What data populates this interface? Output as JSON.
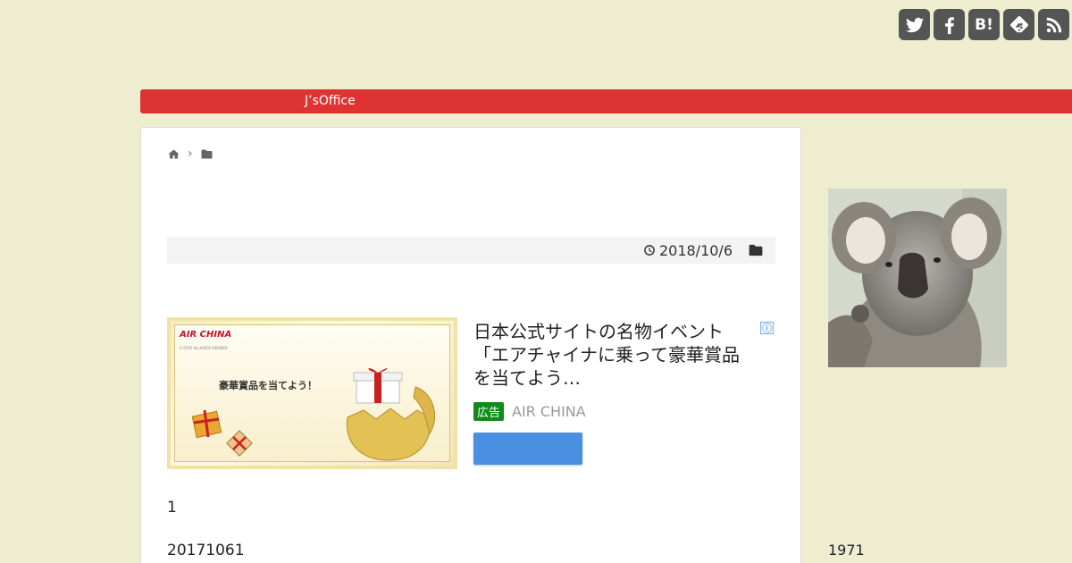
{
  "social": {
    "items": [
      {
        "name": "twitter-icon",
        "glyph": ""
      },
      {
        "name": "facebook-icon",
        "glyph": ""
      },
      {
        "name": "hatena-bookmark-icon",
        "glyph": "B!"
      },
      {
        "name": "feedly-icon",
        "glyph": ""
      },
      {
        "name": "rss-icon",
        "glyph": ""
      }
    ]
  },
  "header": {
    "site_name": "J’sOffice"
  },
  "breadcrumb": {
    "separator": "›"
  },
  "article": {
    "date": "2018/10/6",
    "paragraphs": [
      "1",
      "20171061"
    ]
  },
  "ad": {
    "title": "日本公式サイトの名物イベント「エアチャイナに乗って豪華賞品を当てよう…",
    "badge": "広告",
    "advertiser": "AIR CHINA",
    "image_logo": "AIR CHINA",
    "image_logo_sub": "A STAR ALLIANCE MEMBER",
    "image_text": "豪華賞品を当てよう！",
    "adchoices_glyph": "ⓘ"
  },
  "sidebar": {
    "text": "1971"
  },
  "colors": {
    "background": "#efedd0",
    "nav": "#dd3333",
    "cta": "#4a90e2",
    "badge": "#118a1c"
  }
}
